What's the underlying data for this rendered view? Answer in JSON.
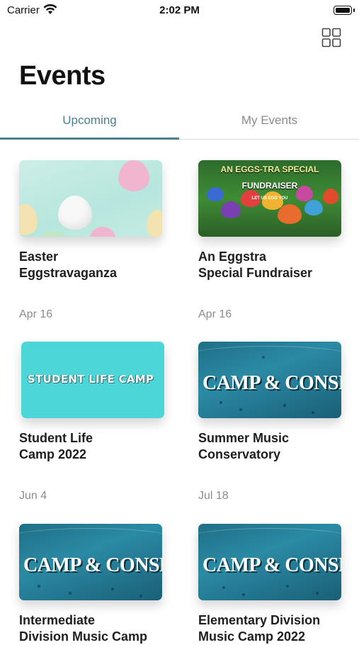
{
  "status": {
    "carrier": "Carrier",
    "time": "2:02 PM"
  },
  "header": {
    "title": "Events"
  },
  "tabs": [
    {
      "label": "Upcoming",
      "active": true
    },
    {
      "label": "My Events",
      "active": false
    }
  ],
  "events": [
    {
      "title_line1": "Easter",
      "title_line2": "Eggstravaganza",
      "date": "Apr 16"
    },
    {
      "title_line1": "An Eggstra",
      "title_line2": "Special Fundraiser",
      "date": "Apr 16",
      "image_text": [
        "AN EGGS-TRA SPECIAL",
        "FUNDRAISER",
        "LET US EGG YOU"
      ]
    },
    {
      "title_line1": "Student Life",
      "title_line2": "Camp 2022",
      "date": "Jun 4",
      "image_text": "STUDENT LIFE CAMP"
    },
    {
      "title_line1": "Summer Music",
      "title_line2": "Conservatory",
      "date": "Jul 18",
      "image_text": "CAMP & CONSERV"
    },
    {
      "title_line1": "Intermediate",
      "title_line2": "Division Music Camp",
      "image_text": "CAMP & CONSERV"
    },
    {
      "title_line1": "Elementary Division",
      "title_line2": "Music Camp 2022",
      "image_text": "CAMP & CONSERV"
    }
  ],
  "colors": {
    "accent": "#4d7f8e",
    "inactive_tab": "#8a8a8a",
    "date": "#8c8c8c"
  },
  "icons": {
    "layout_toggle": "grid-icon",
    "wifi": "wifi-icon",
    "battery": "battery-icon"
  }
}
